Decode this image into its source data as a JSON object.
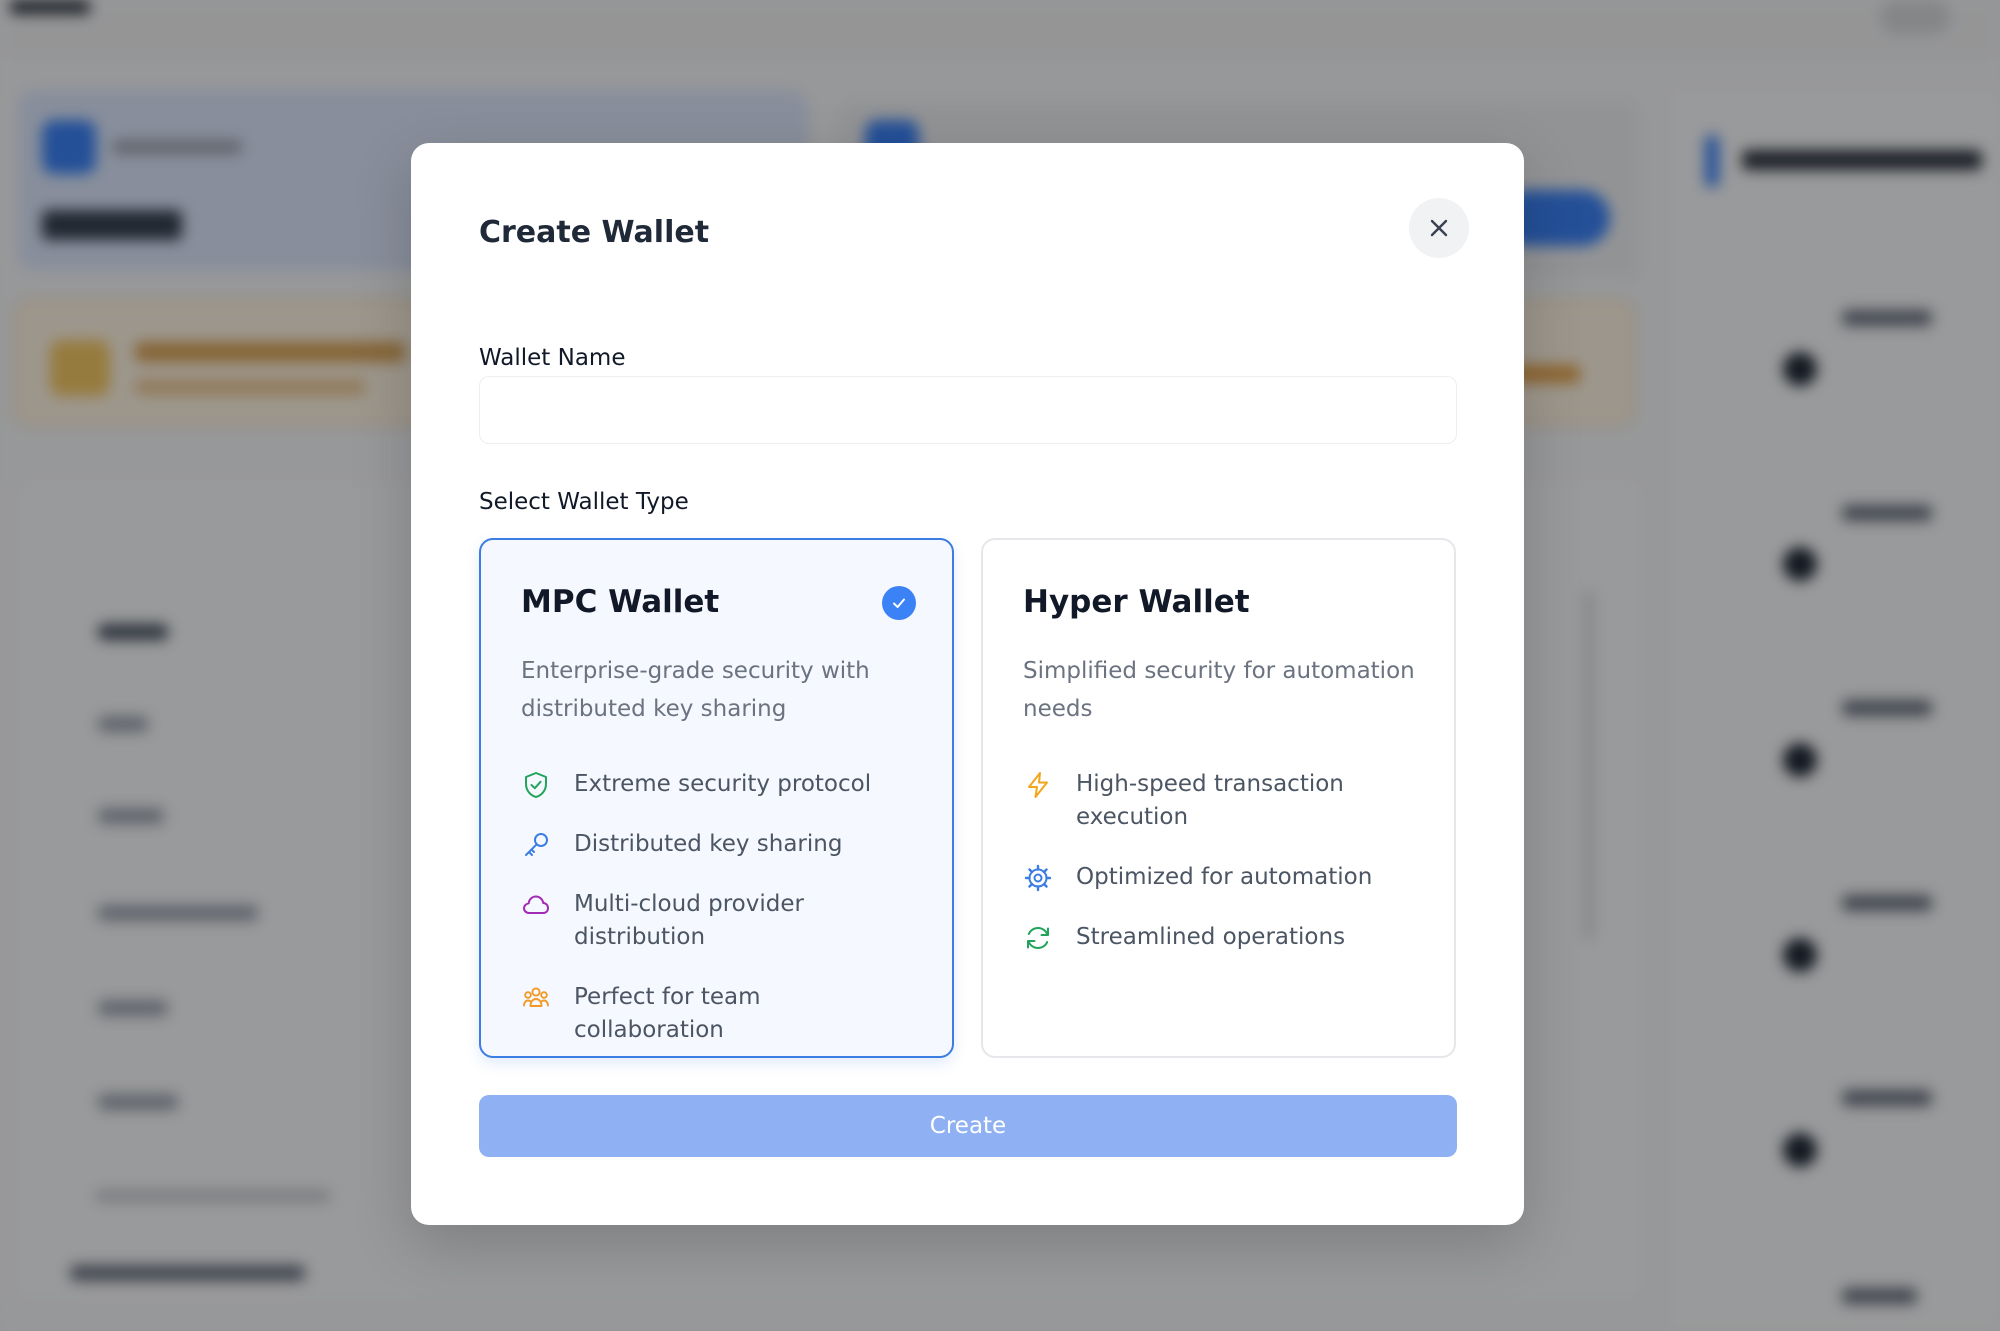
{
  "modal": {
    "title": "Create Wallet",
    "close_label": "close"
  },
  "form": {
    "wallet_name_label": "Wallet Name",
    "wallet_name_value": "",
    "wallet_name_placeholder": "",
    "wallet_type_label": "Select Wallet Type"
  },
  "wallet_types": [
    {
      "title": "MPC Wallet",
      "selected": true,
      "description": "Enterprise-grade security with distributed key sharing",
      "features": [
        {
          "icon": "shield-check-icon",
          "label": "Extreme security protocol",
          "color": "#22a45a"
        },
        {
          "icon": "key-icon",
          "label": "Distributed key sharing",
          "color": "#3b7de3"
        },
        {
          "icon": "cloud-icon",
          "label": "Multi-cloud provider distribution",
          "color": "#a22bb5"
        },
        {
          "icon": "users-icon",
          "label": "Perfect for team collaboration",
          "color": "#f29a24"
        }
      ]
    },
    {
      "title": "Hyper Wallet",
      "selected": false,
      "description": "Simplified security for automation needs",
      "features": [
        {
          "icon": "lightning-icon",
          "label": "High-speed transaction execution",
          "color": "#f2a71b"
        },
        {
          "icon": "gear-icon",
          "label": "Optimized for automation",
          "color": "#3b7de3"
        },
        {
          "icon": "refresh-icon",
          "label": "Streamlined operations",
          "color": "#22a45a"
        }
      ]
    }
  ],
  "actions": {
    "create_label": "Create"
  },
  "colors": {
    "accent": "#3b82f6",
    "create_disabled": "#8fb0f2",
    "selected_border": "#3b7de3",
    "selected_bg": "#f5f8fe"
  }
}
